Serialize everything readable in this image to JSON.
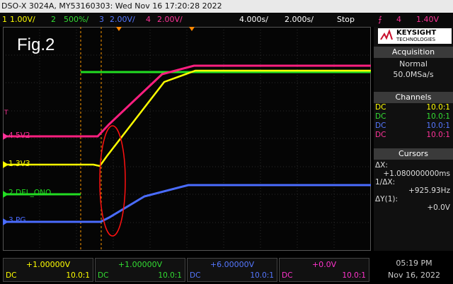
{
  "window": {
    "title": "DSO-X 3024A, MY53160303: Wed Nov 16 17:20:28 2022"
  },
  "topbar": {
    "ch1_num": "1",
    "ch1_scale": "1.00V/",
    "ch2_num": "2",
    "ch2_scale": "500%/",
    "ch3_num": "3",
    "ch3_scale": "2.00V/",
    "ch4_num": "4",
    "ch4_scale": "2.00V/",
    "timebase": "4.000s/",
    "delay": "2.000s/",
    "run_state": "Stop",
    "trigger_level": "1.40V"
  },
  "screen": {
    "fig_label": "Fig.2",
    "markers": [
      {
        "num": "4",
        "label": "5V2"
      },
      {
        "num": "1",
        "label": "3V3"
      },
      {
        "num": "2",
        "label": "DEL_ONO"
      },
      {
        "num": "3",
        "label": "PG"
      }
    ],
    "trigger_marker": "T"
  },
  "side": {
    "brand": "KEYSIGHT",
    "brand_sub": "TECHNOLOGIES",
    "acquisition": {
      "title": "Acquisition",
      "mode": "Normal",
      "rate": "50.0MSa/s"
    },
    "channels": {
      "title": "Channels",
      "rows": [
        {
          "coupling": "DC",
          "probe": "10.0:1",
          "color": "#ffff00"
        },
        {
          "coupling": "DC",
          "probe": "10.0:1",
          "color": "#33dd33"
        },
        {
          "coupling": "DC",
          "probe": "10.0:1",
          "color": "#5577ff"
        },
        {
          "coupling": "DC",
          "probe": "10.0:1",
          "color": "#ff3399"
        }
      ]
    },
    "cursors": {
      "title": "Cursors",
      "dx_label": "ΔX:",
      "dx_value": "+1.080000000ms",
      "inv_label": "1/ΔX:",
      "inv_value": "+925.93Hz",
      "dy_label": "ΔY(1):",
      "dy_value": "+0.0V"
    }
  },
  "bottom": {
    "channels": [
      {
        "value": "+1.00000V",
        "coupling": "DC",
        "probe": "10.0:1",
        "color": "#ffff00"
      },
      {
        "value": "+1.00000V",
        "coupling": "DC",
        "probe": "10.0:1",
        "color": "#33dd33"
      },
      {
        "value": "+6.00000V",
        "coupling": "DC",
        "probe": "10.0:1",
        "color": "#5577ff"
      },
      {
        "value": "+0.0V",
        "coupling": "DC",
        "probe": "10.0:1",
        "color": "#ff33cc"
      }
    ]
  },
  "clock": {
    "time": "05:19 PM",
    "date": "Nov 16, 2022"
  }
}
